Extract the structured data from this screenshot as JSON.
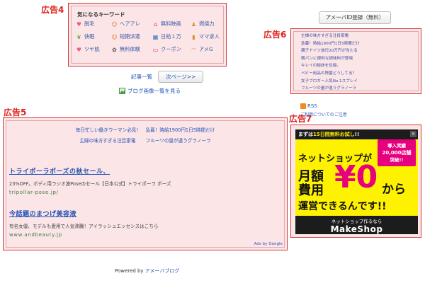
{
  "labels": {
    "ad4": "広告4",
    "ad5": "広告5",
    "ad6": "広告6",
    "ad7": "広告7"
  },
  "ad4": {
    "title": "気になるキーワード",
    "keywords": [
      {
        "label": "脱毛",
        "icon": "heart-icon",
        "color": "#e85c8e"
      },
      {
        "label": "ヘアアレ",
        "icon": "woman-face-icon",
        "color": "#e07a2e"
      },
      {
        "label": "無料映画",
        "icon": "house-icon",
        "color": "#e0303a"
      },
      {
        "label": "燃焼力",
        "icon": "person-icon",
        "color": "#e0943a"
      },
      {
        "label": "快眠",
        "icon": "leaf-icon",
        "color": "#5aa53a"
      },
      {
        "label": "短期派遣",
        "icon": "woman-face-icon",
        "color": "#e07a2e"
      },
      {
        "label": "日給１万",
        "icon": "calculator-icon",
        "color": "#2e6fc0"
      },
      {
        "label": "ママ求人",
        "icon": "bottle-icon",
        "color": "#d88a2a"
      },
      {
        "label": "ツヤ肌",
        "icon": "heart-icon",
        "color": "#e85c8e"
      },
      {
        "label": "無料体験",
        "icon": "gear-icon",
        "color": "#555555"
      },
      {
        "label": "クーポン",
        "icon": "ticket-icon",
        "color": "#e0303a"
      },
      {
        "label": "アメG",
        "icon": "rainbow-icon",
        "color": "#e0943a"
      }
    ]
  },
  "nav": {
    "article_list": "記事一覧",
    "next_page": "次ページ>>",
    "image_list": "ブログ画像一覧を見る"
  },
  "register_button": "アメーバID登録（無料）",
  "ad6": {
    "items": [
      "主婦の味方すぎる注目家電",
      "急募！時給1900円1日5時間だけ",
      "親子ドイツ旅行20万円が当たる",
      "朝パンに便利な調味料が登場",
      "キレイの秘訣を伝授。",
      "ベビー用品の除菌どうしてる？",
      "女子ブロガー人気No.1スプレイ",
      "フルーツの量が違うグラノーラ"
    ]
  },
  "rss": {
    "label": "RSS",
    "note": "ご利用についてのご注意"
  },
  "ad5": {
    "top_links_row1": "毎日忙しい働きウーマン必見！　急募！時給1900円1日5時間だけ",
    "top_links_row2": [
      "主婦の味方すぎる注目家電",
      "フルーツの量が違うグラノーラ"
    ],
    "items": [
      {
        "title": "トライポーラポーズの秋セール、",
        "desc": "23%OFF。ボディ用ラジオ波Poseのセール【日本公式】トライポーラ ポーズ",
        "url": "tripollar-pose.jp/"
      },
      {
        "title": "今話題のまつげ美容液",
        "desc": "有名女優、モデルも愛用で人気沸騰！アイラッシュエッセンスはこちら",
        "url": "www.andbeauty.jp"
      }
    ],
    "ads_by": "Ads by Google"
  },
  "ad7": {
    "top_text_pre": "まずは",
    "top_text_hl": "15日間無料お試し",
    "top_text_post": "!!",
    "close": "×",
    "badge": [
      "導入実績",
      "20,000店舗",
      "突破!!"
    ],
    "line1": "ネットショップが",
    "line2": "月額",
    "line3": "費用",
    "yen": "¥0",
    "kara": "から",
    "line4": "運営できるんです!!",
    "bottom_small": "ネットショップ作るなら",
    "brand": "MakeShop"
  },
  "powered": {
    "prefix": "Powered by ",
    "brand": "アメーバブログ"
  },
  "colors": {
    "ad_label": "#e0201b",
    "ad_box_bg": "#fbe5e7",
    "link": "#2453b5",
    "banner_yellow": "#fff200",
    "banner_magenta": "#e6007e"
  }
}
